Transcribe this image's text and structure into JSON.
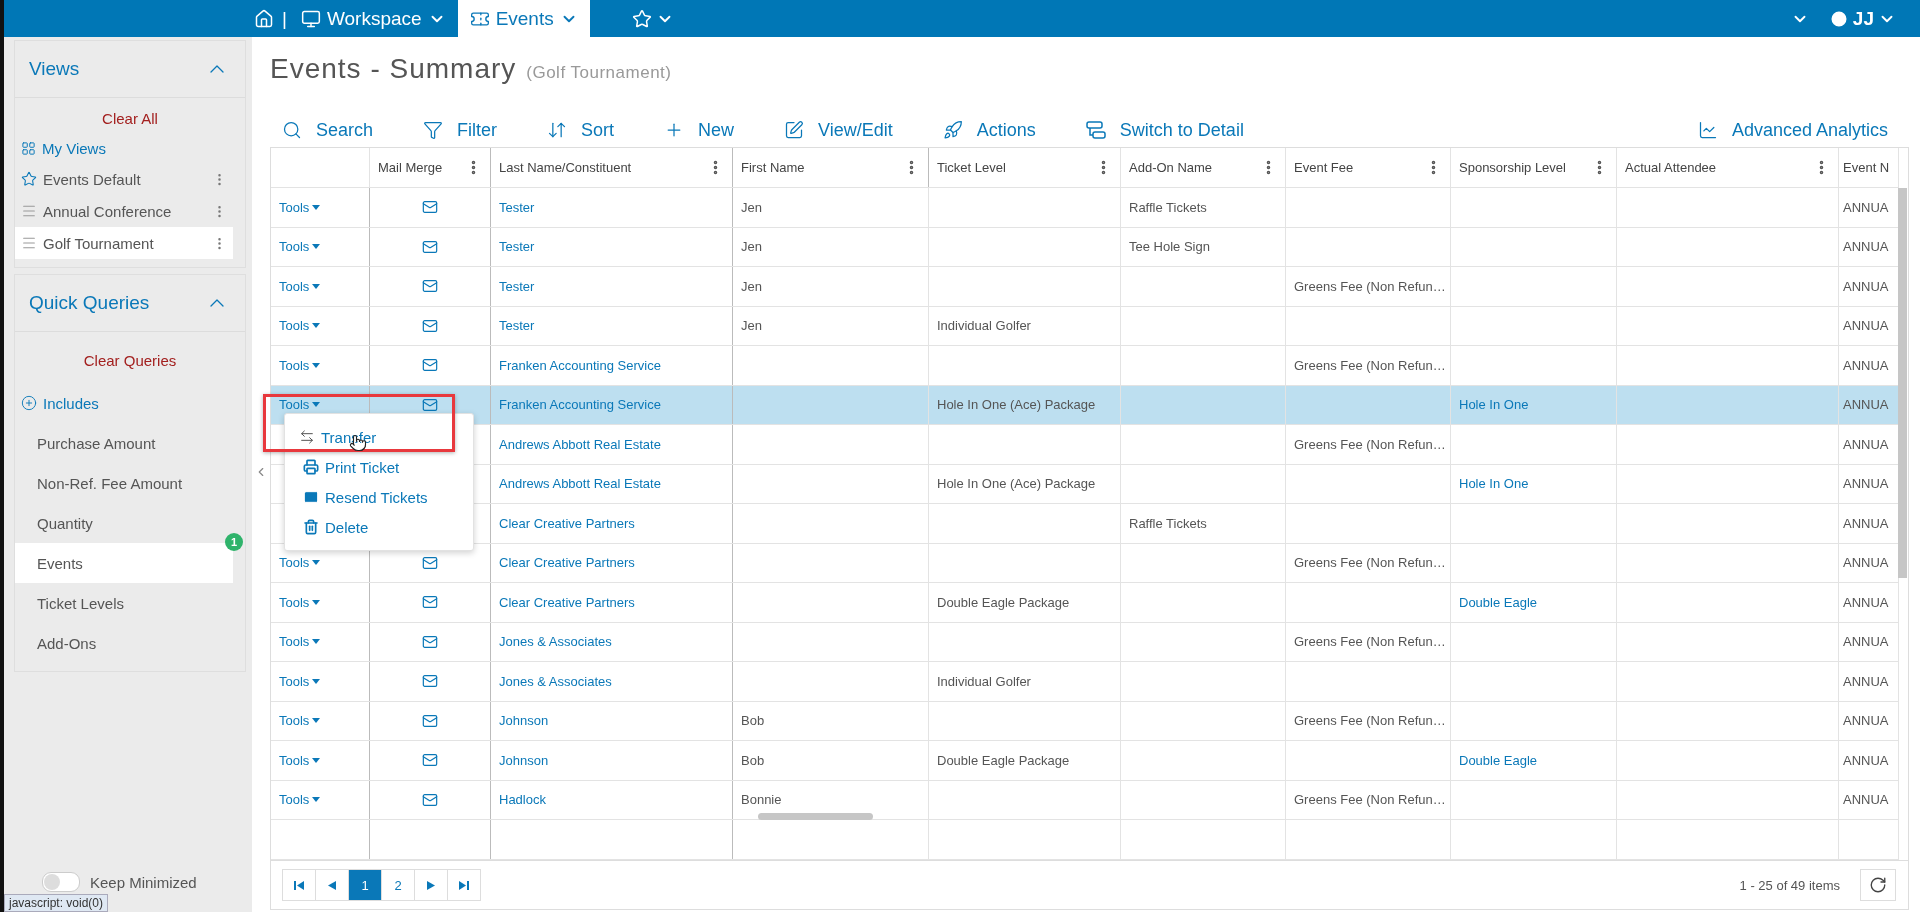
{
  "nav_separator": "|",
  "nav": [
    {
      "label": "Workspace",
      "selected": false
    },
    {
      "label": "Events",
      "selected": true
    }
  ],
  "user": {
    "initials": "JJ"
  },
  "sidebar": {
    "views": {
      "title": "Views",
      "clear": "Clear All",
      "my_views": "My Views",
      "items": [
        {
          "label": "Events Default",
          "kind": "star",
          "selected": false
        },
        {
          "label": "Annual Conference",
          "kind": "list",
          "selected": false
        },
        {
          "label": "Golf Tournament",
          "kind": "list",
          "selected": true
        }
      ]
    },
    "quick_queries": {
      "title": "Quick Queries",
      "clear": "Clear Queries",
      "includes": "Includes",
      "items": [
        {
          "label": "Purchase Amount",
          "selected": false
        },
        {
          "label": "Non-Ref. Fee Amount",
          "selected": false
        },
        {
          "label": "Quantity",
          "selected": false
        },
        {
          "label": "Events",
          "selected": true,
          "badge": "1"
        },
        {
          "label": "Ticket Levels",
          "selected": false
        },
        {
          "label": "Add-Ons",
          "selected": false
        }
      ]
    },
    "keep_minimized": {
      "label": "Keep Minimized",
      "on": false
    }
  },
  "page": {
    "title": "Events - Summary",
    "subtitle": "(Golf Tournament)"
  },
  "toolbar": [
    {
      "label": "Search",
      "kind": "search"
    },
    {
      "label": "Filter",
      "kind": "filter"
    },
    {
      "label": "Sort",
      "kind": "sort"
    },
    {
      "label": "New",
      "kind": "new"
    },
    {
      "label": "View/Edit",
      "kind": "edit"
    },
    {
      "label": "Actions",
      "kind": "actions"
    },
    {
      "label": "Switch to Detail",
      "kind": "detail"
    }
  ],
  "analytics_button": {
    "label": "Advanced Analytics"
  },
  "table": {
    "columns": [
      {
        "menu": false
      },
      {
        "label": "Mail Merge",
        "menu": true
      },
      {
        "label": "Last Name/Constituent",
        "menu": true
      },
      {
        "label": "First Name",
        "menu": true
      },
      {
        "label": "Ticket Level",
        "menu": true
      },
      {
        "label": "Add-On Name",
        "menu": true
      },
      {
        "label": "Event Fee",
        "menu": true
      },
      {
        "label": "Sponsorship Level",
        "menu": true
      },
      {
        "label": "Actual Attendee",
        "menu": true
      },
      {
        "label": "Event N",
        "menu": false
      }
    ],
    "rows": [
      {
        "tools": "Tools",
        "selected": false,
        "last_name": "Tester",
        "first_name": "Jen",
        "add_on": "Raffle Tickets",
        "event": "ANNUA"
      },
      {
        "tools": "Tools",
        "selected": false,
        "last_name": "Tester",
        "first_name": "Jen",
        "add_on": "Tee Hole Sign",
        "event": "ANNUA"
      },
      {
        "tools": "Tools",
        "selected": false,
        "last_name": "Tester",
        "first_name": "Jen",
        "event_fee": "Greens Fee (Non Refun…",
        "event": "ANNUA"
      },
      {
        "tools": "Tools",
        "selected": false,
        "last_name": "Tester",
        "first_name": "Jen",
        "ticket_level": "Individual Golfer",
        "event": "ANNUA"
      },
      {
        "tools": "Tools",
        "selected": false,
        "last_name": "Franken Accounting Service",
        "event_fee": "Greens Fee (Non Refun…",
        "event": "ANNUA"
      },
      {
        "tools": "Tools",
        "selected": true,
        "last_name": "Franken Accounting Service",
        "ticket_level": "Hole In One (Ace) Package",
        "sponsorship": "Hole In One",
        "event": "ANNUA"
      },
      {
        "selected": false,
        "last_name": "Andrews Abbott Real Estate",
        "event_fee": "Greens Fee (Non Refun…",
        "event": "ANNUA"
      },
      {
        "selected": false,
        "last_name": "Andrews Abbott Real Estate",
        "ticket_level": "Hole In One (Ace) Package",
        "sponsorship": "Hole In One",
        "event": "ANNUA"
      },
      {
        "selected": false,
        "last_name": "Clear Creative Partners",
        "add_on": "Raffle Tickets",
        "event": "ANNUA"
      },
      {
        "tools": "Tools",
        "selected": false,
        "last_name": "Clear Creative Partners",
        "event_fee": "Greens Fee (Non Refun…",
        "event": "ANNUA"
      },
      {
        "tools": "Tools",
        "selected": false,
        "last_name": "Clear Creative Partners",
        "ticket_level": "Double Eagle Package",
        "sponsorship": "Double Eagle",
        "event": "ANNUA"
      },
      {
        "tools": "Tools",
        "selected": false,
        "last_name": "Jones & Associates",
        "event_fee": "Greens Fee (Non Refun…",
        "event": "ANNUA"
      },
      {
        "tools": "Tools",
        "selected": false,
        "last_name": "Jones & Associates",
        "ticket_level": "Individual Golfer",
        "event": "ANNUA"
      },
      {
        "tools": "Tools",
        "selected": false,
        "last_name": "Johnson",
        "first_name": "Bob",
        "event_fee": "Greens Fee (Non Refun…",
        "event": "ANNUA"
      },
      {
        "tools": "Tools",
        "selected": false,
        "last_name": "Johnson",
        "first_name": "Bob",
        "ticket_level": "Double Eagle Package",
        "sponsorship": "Double Eagle",
        "event": "ANNUA"
      },
      {
        "tools": "Tools",
        "selected": false,
        "last_name": "Hadlock",
        "first_name": "Bonnie",
        "event_fee": "Greens Fee (Non Refun…",
        "event": "ANNUA"
      }
    ]
  },
  "row_menu": {
    "items": [
      {
        "label": "Transfer",
        "kind": "transfer",
        "annotated": true
      },
      {
        "label": "Print Ticket",
        "kind": "print",
        "annotated": false
      },
      {
        "label": "Resend Tickets",
        "kind": "resend",
        "annotated": false
      },
      {
        "label": "Delete",
        "kind": "delete",
        "annotated": false
      }
    ]
  },
  "pager": {
    "pages": [
      {
        "label": "1",
        "selected": true
      },
      {
        "label": "2",
        "selected": false
      }
    ],
    "summary": "1 - 25 of 49 items"
  },
  "status_tip": "javascript: void(0)"
}
